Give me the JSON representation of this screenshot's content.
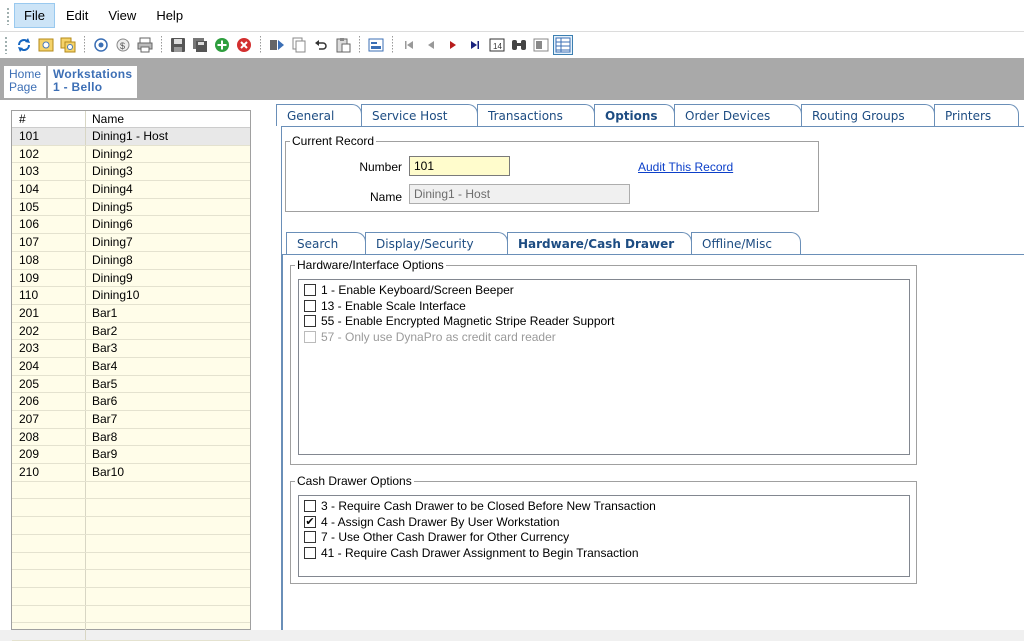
{
  "menu": {
    "file": "File",
    "edit": "Edit",
    "view": "View",
    "help": "Help"
  },
  "breadcrumb": {
    "home_line1": "Home",
    "home_line2": "Page",
    "current_line1": "Workstations",
    "current_line2": "1 - Bello"
  },
  "list": {
    "header_num": "#",
    "header_name": "Name",
    "rows": [
      {
        "num": "101",
        "name": "Dining1 - Host"
      },
      {
        "num": "102",
        "name": "Dining2"
      },
      {
        "num": "103",
        "name": "Dining3"
      },
      {
        "num": "104",
        "name": "Dining4"
      },
      {
        "num": "105",
        "name": "Dining5"
      },
      {
        "num": "106",
        "name": "Dining6"
      },
      {
        "num": "107",
        "name": "Dining7"
      },
      {
        "num": "108",
        "name": "Dining8"
      },
      {
        "num": "109",
        "name": "Dining9"
      },
      {
        "num": "110",
        "name": "Dining10"
      },
      {
        "num": "201",
        "name": "Bar1"
      },
      {
        "num": "202",
        "name": "Bar2"
      },
      {
        "num": "203",
        "name": "Bar3"
      },
      {
        "num": "204",
        "name": "Bar4"
      },
      {
        "num": "205",
        "name": "Bar5"
      },
      {
        "num": "206",
        "name": "Bar6"
      },
      {
        "num": "207",
        "name": "Bar7"
      },
      {
        "num": "208",
        "name": "Bar8"
      },
      {
        "num": "209",
        "name": "Bar9"
      },
      {
        "num": "210",
        "name": "Bar10"
      }
    ]
  },
  "main_tabs": [
    "General",
    "Service Host",
    "Transactions",
    "Options",
    "Order Devices",
    "Routing Groups",
    "Printers"
  ],
  "main_tab_active": "Options",
  "current_record": {
    "legend": "Current Record",
    "number_label": "Number",
    "number_value": "101",
    "name_label": "Name",
    "name_value": "Dining1 - Host",
    "audit_link": "Audit This Record"
  },
  "sub_tabs": [
    "Search",
    "Display/Security",
    "Hardware/Cash Drawer",
    "Offline/Misc"
  ],
  "sub_tab_active": "Hardware/Cash Drawer",
  "hardware": {
    "legend": "Hardware/Interface Options",
    "options": [
      {
        "label": "1 - Enable Keyboard/Screen Beeper",
        "checked": false,
        "disabled": false
      },
      {
        "label": "13 - Enable Scale Interface",
        "checked": false,
        "disabled": false
      },
      {
        "label": "55 - Enable Encrypted Magnetic Stripe Reader Support",
        "checked": false,
        "disabled": false
      },
      {
        "label": "57 - Only use DynaPro as credit card reader",
        "checked": false,
        "disabled": true
      }
    ]
  },
  "cash_drawer": {
    "legend": "Cash Drawer Options",
    "options": [
      {
        "label": "3 - Require Cash Drawer to be Closed Before New Transaction",
        "checked": false,
        "disabled": false
      },
      {
        "label": "4 - Assign Cash Drawer By User Workstation",
        "checked": true,
        "disabled": false
      },
      {
        "label": "7 - Use Other Cash Drawer for Other Currency",
        "checked": false,
        "disabled": false
      },
      {
        "label": "41 - Require Cash Drawer Assignment to Begin Transaction",
        "checked": false,
        "disabled": false
      }
    ]
  },
  "colors": {
    "accent": "#1d4c82",
    "list_bg": "#fffde9",
    "link": "#0b3fc9",
    "input_highlight": "#fffccc"
  }
}
